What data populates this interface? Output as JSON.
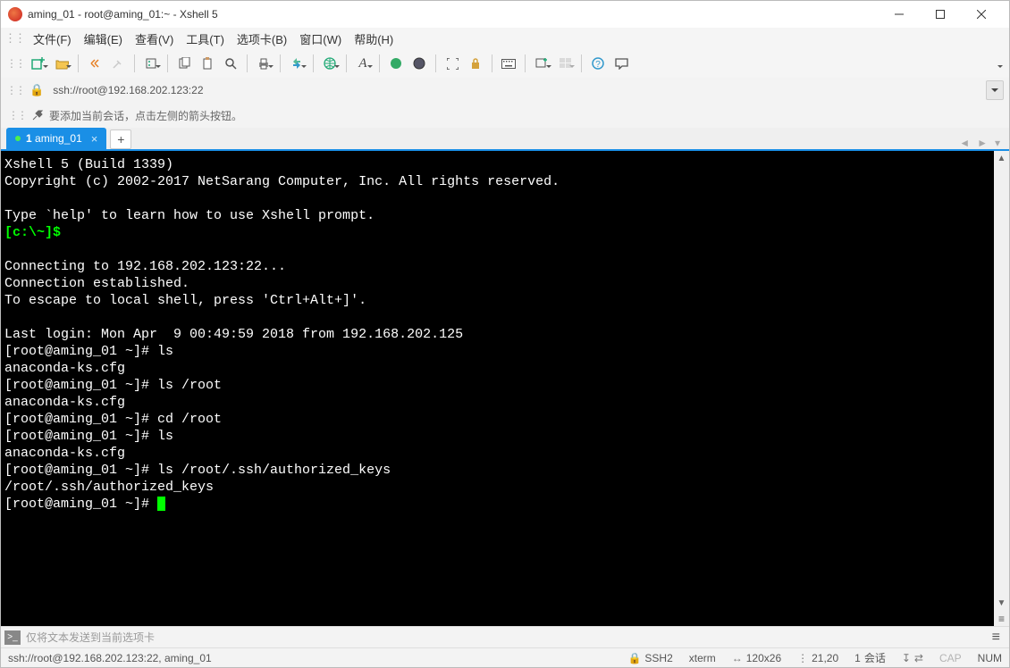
{
  "window": {
    "title": "aming_01 - root@aming_01:~ - Xshell 5"
  },
  "menu": [
    "文件(F)",
    "编辑(E)",
    "查看(V)",
    "工具(T)",
    "选项卡(B)",
    "窗口(W)",
    "帮助(H)"
  ],
  "address": {
    "url": "ssh://root@192.168.202.123:22"
  },
  "hint": "要添加当前会话，点击左侧的箭头按钮。",
  "tab": {
    "index": "1",
    "label": "aming_01"
  },
  "terminal": {
    "lines": [
      "Xshell 5 (Build 1339)",
      "Copyright (c) 2002-2017 NetSarang Computer, Inc. All rights reserved.",
      "",
      "Type `help' to learn how to use Xshell prompt.",
      {
        "prompt": "[c:\\~]$",
        "cmd": ""
      },
      "",
      "Connecting to 192.168.202.123:22...",
      "Connection established.",
      "To escape to local shell, press 'Ctrl+Alt+]'.",
      "",
      "Last login: Mon Apr  9 00:49:59 2018 from 192.168.202.125",
      "[root@aming_01 ~]# ls",
      "anaconda-ks.cfg",
      "[root@aming_01 ~]# ls /root",
      "anaconda-ks.cfg",
      "[root@aming_01 ~]# cd /root",
      "[root@aming_01 ~]# ls",
      "anaconda-ks.cfg",
      "[root@aming_01 ~]# ls /root/.ssh/authorized_keys",
      "/root/.ssh/authorized_keys",
      {
        "line": "[root@aming_01 ~]# ",
        "cursor": true
      }
    ]
  },
  "sendbar": "仅将文本发送到当前选项卡",
  "status": {
    "left": "ssh://root@192.168.202.123:22, aming_01",
    "protocol": "SSH2",
    "term": "xterm",
    "size": "120x26",
    "pos": "21,20",
    "sessions_label": "会话",
    "sessions": "1",
    "cap": "CAP",
    "num": "NUM"
  }
}
